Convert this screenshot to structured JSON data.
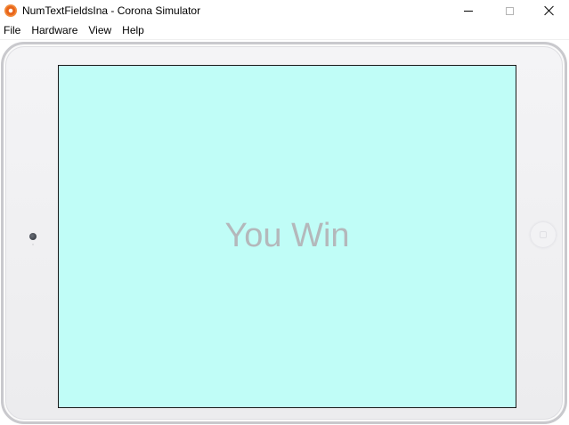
{
  "window": {
    "title": "NumTextFieldsIna - Corona Simulator",
    "icon": "corona-app-icon",
    "controls": [
      "minimize",
      "maximize",
      "close"
    ]
  },
  "menu": {
    "items": [
      {
        "label": "File"
      },
      {
        "label": "Hardware"
      },
      {
        "label": "View"
      },
      {
        "label": "Help"
      }
    ]
  },
  "simulator": {
    "device": "tablet-landscape",
    "screen_color": "#c0fdf7",
    "message": "You Win",
    "message_color": "#b4b8bb"
  }
}
